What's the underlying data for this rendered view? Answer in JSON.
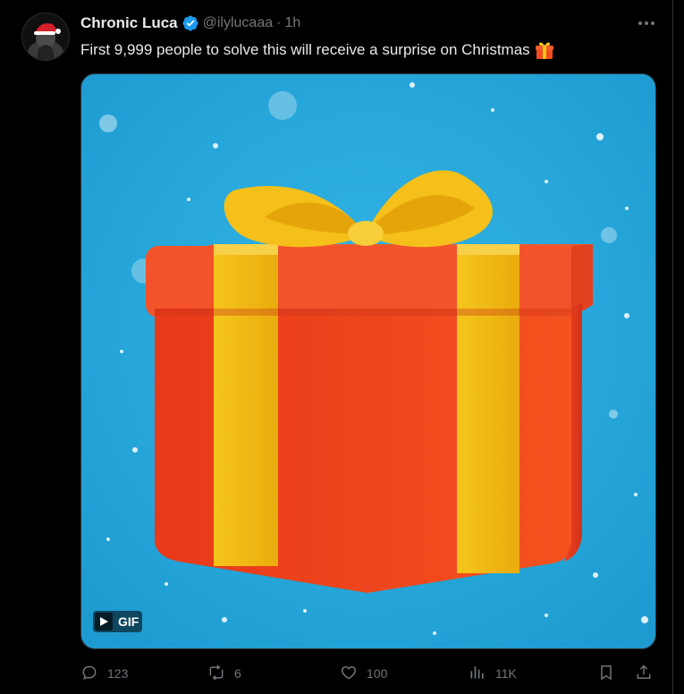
{
  "author": {
    "display_name": "Chronic Luca",
    "handle": "@ilylucaaa",
    "separator": "·",
    "time": "1h",
    "verified": true
  },
  "tweet": {
    "text": "First 9,999 people to solve this will receive a surprise on Christmas",
    "emoji": "gift-emoji"
  },
  "media": {
    "type": "gif",
    "badge_label": "GIF",
    "subject": "gift-box"
  },
  "actions": {
    "reply_count": "123",
    "retweet_count": "6",
    "like_count": "100",
    "views_count": "11K"
  },
  "colors": {
    "background": "#000000",
    "text": "#e7e9ea",
    "muted": "#71767b",
    "verified": "#1d9bf0",
    "media_bg": "#27a8dc",
    "box_red": "#f24a1e",
    "ribbon_yellow": "#f5c518"
  },
  "icons": [
    "verified-badge-icon",
    "more-icon",
    "play-icon",
    "reply-icon",
    "retweet-icon",
    "like-icon",
    "views-icon",
    "bookmark-icon",
    "share-icon"
  ]
}
